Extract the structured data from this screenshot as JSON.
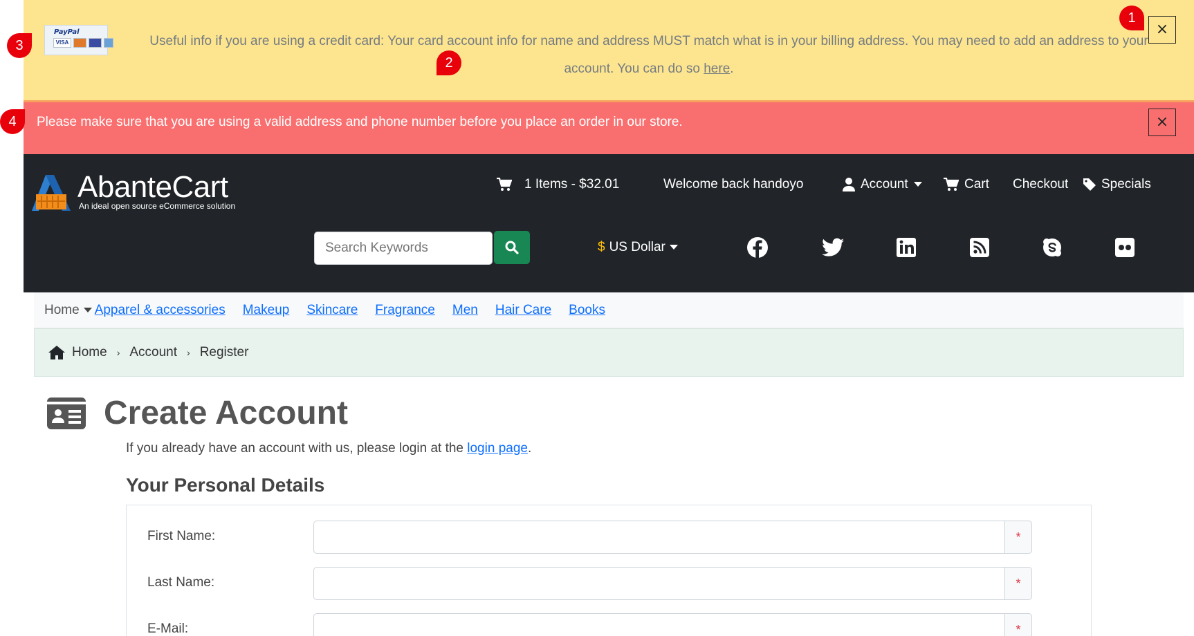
{
  "notice_card": {
    "paypal_label": "PayPal",
    "visa_label": "VISA",
    "text": "Useful info if you are using a credit card: Your card account info for name and address MUST match what is in your billing address. You may need to add an address to your account. You can do so ",
    "link": "here",
    "suffix": "."
  },
  "notice_address": {
    "text": "Please make sure that you are using a valid address and phone number before you place an order in our store."
  },
  "close_glyph": "×",
  "brand": {
    "name": "AbanteCart",
    "tagline": "An ideal open source eCommerce solution"
  },
  "topnav": {
    "cart_summary": "1 Items - $32.01",
    "welcome": "Welcome back handoyo",
    "account": "Account",
    "cart": "Cart",
    "checkout": "Checkout",
    "specials": "Specials"
  },
  "search": {
    "placeholder": "Search Keywords"
  },
  "currency": {
    "symbol": "$",
    "label": "US Dollar"
  },
  "social_icons": [
    "facebook-icon",
    "twitter-icon",
    "linkedin-icon",
    "rss-icon",
    "skype-icon",
    "flickr-icon"
  ],
  "categories": {
    "home": "Home",
    "items": [
      "Apparel & accessories",
      "Makeup",
      "Skincare",
      "Fragrance",
      "Men",
      "Hair Care",
      "Books"
    ]
  },
  "breadcrumb": {
    "home": "Home",
    "account": "Account",
    "current": "Register",
    "separator": "›"
  },
  "page": {
    "title": "Create Account",
    "intro_prefix": "If you already have an account with us, please login at the ",
    "intro_link": "login page",
    "intro_suffix": ".",
    "section_title": "Your Personal Details"
  },
  "form": {
    "first_name_label": "First Name:",
    "last_name_label": "Last Name:",
    "email_label": "E-Mail:",
    "required_mark": "*"
  },
  "markers": [
    "1",
    "2",
    "3",
    "4"
  ],
  "colors": {
    "notice_yellow": "#fde58f",
    "notice_red": "#f96f6f",
    "header_dark": "#212529",
    "search_green": "#198754",
    "link_blue": "#0d6efd",
    "marker_red": "#e8000b"
  }
}
